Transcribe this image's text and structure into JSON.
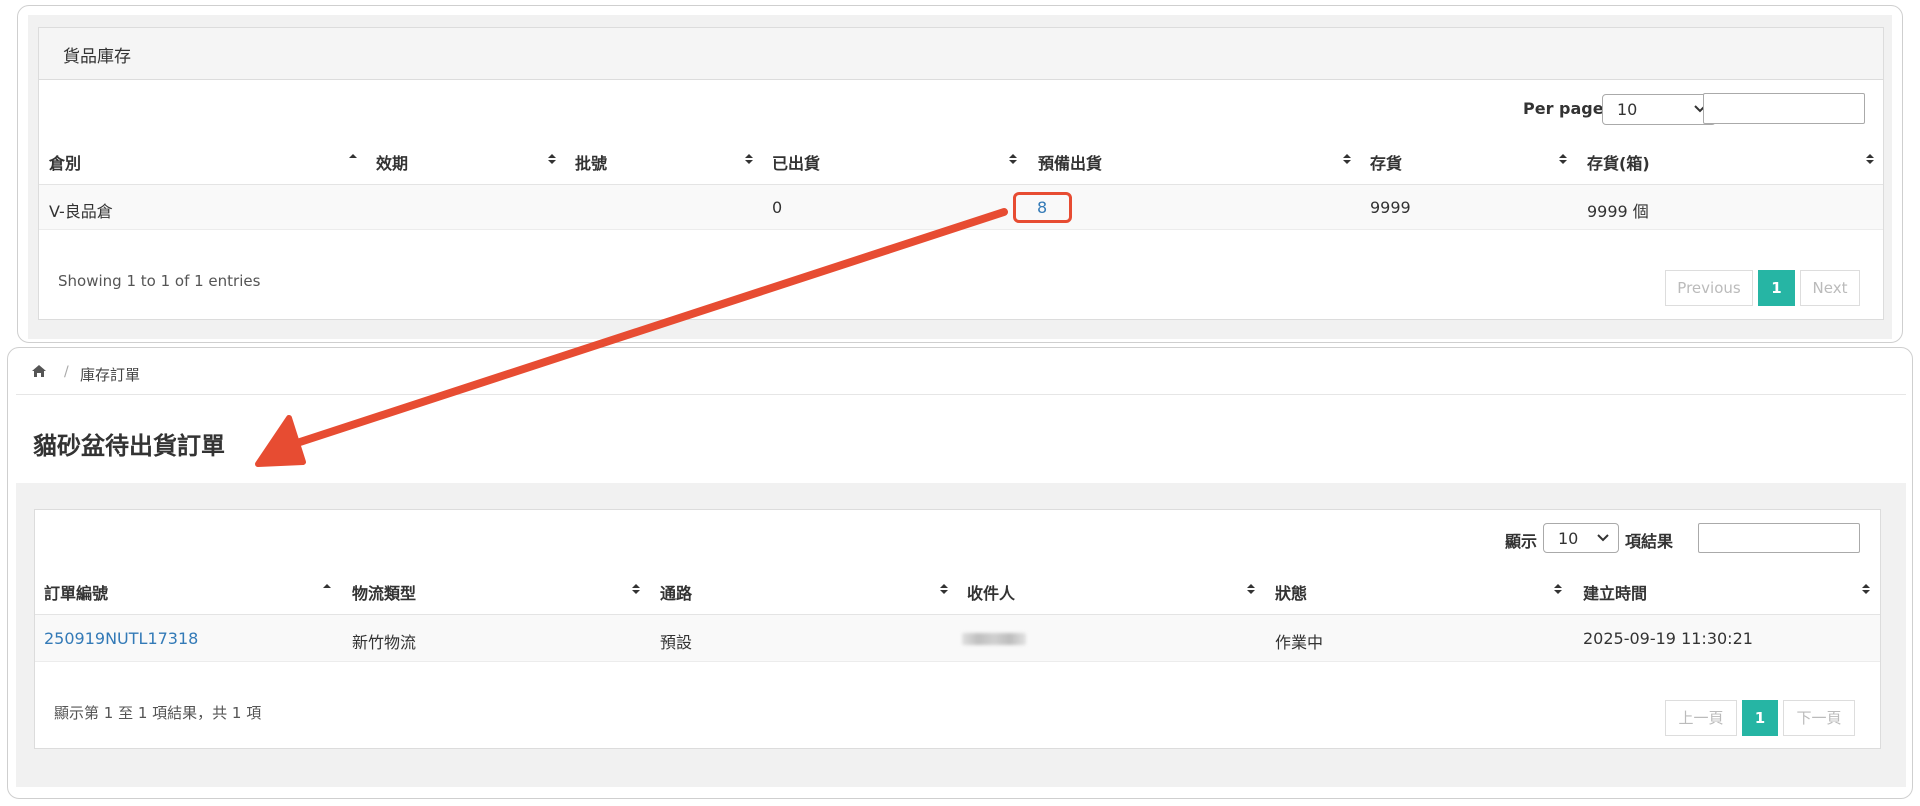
{
  "inventory": {
    "panel_title": "貨品庫存",
    "per_page_label": "Per page:",
    "per_page_value": "10",
    "columns": [
      "倉別",
      "效期",
      "批號",
      "已出貨",
      "預備出貨",
      "存貨",
      "存貨(箱)"
    ],
    "rows": [
      [
        "V-良品倉",
        "",
        "",
        "0",
        "8",
        "9999",
        "9999 個"
      ]
    ],
    "info_text": "Showing 1 to 1 of 1 entries",
    "pagination": {
      "previous": "Previous",
      "page": "1",
      "next": "Next"
    }
  },
  "orders": {
    "breadcrumb": "庫存訂單",
    "page_title": "貓砂盆待出貨訂單",
    "show_label": "顯示",
    "per_page_value": "10",
    "results_label": "項結果",
    "columns": [
      "訂單編號",
      "物流類型",
      "通路",
      "收件人",
      "狀態",
      "建立時間"
    ],
    "rows": [
      [
        "250919NUTL17318",
        "新竹物流",
        "預設",
        "",
        "作業中",
        "2025-09-19 11:30:21"
      ]
    ],
    "info_text": "顯示第 1 至 1 項結果，共 1 項",
    "pagination": {
      "previous": "上一頁",
      "page": "1",
      "next": "下一頁"
    }
  },
  "annotation": {
    "color": "#e74c32"
  },
  "colors": {
    "accent": "#26b5a4",
    "link": "#337ab7"
  }
}
